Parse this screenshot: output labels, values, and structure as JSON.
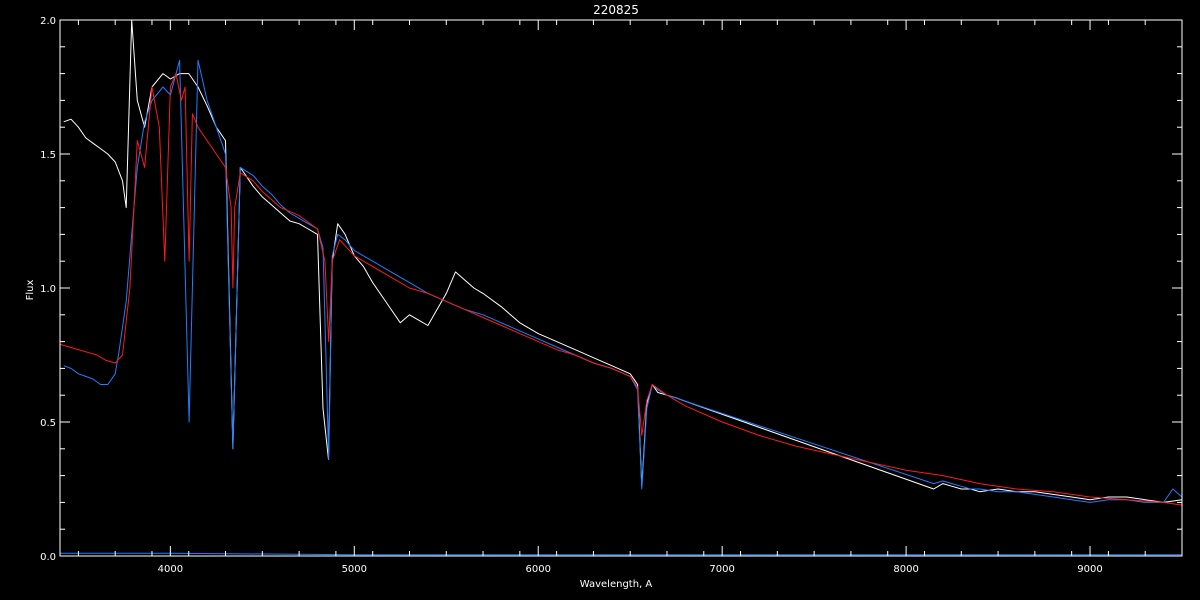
{
  "chart_data": {
    "type": "line",
    "title": "220825",
    "xlabel": "Wavelength, A",
    "ylabel": "Flux",
    "xlim": [
      3400,
      9500
    ],
    "ylim": [
      0,
      2.0
    ],
    "x_ticks": [
      4000,
      5000,
      6000,
      7000,
      8000,
      9000
    ],
    "x_tick_labels": [
      "4000",
      "5000",
      "6000",
      "7000",
      "8000",
      "9000"
    ],
    "y_ticks": [
      0,
      0.5,
      1.0,
      1.5,
      2.0
    ],
    "y_tick_labels": [
      "0.0",
      "0.5",
      "1.0",
      "1.5",
      "2.0"
    ],
    "grid": false,
    "colors": {
      "background": "#000000",
      "axes": "#ffffff",
      "white": "#ffffff",
      "blue": "#1e7fff",
      "red": "#ff1a1a"
    },
    "series": [
      {
        "color": "white",
        "x": [
          3420,
          3460,
          3500,
          3540,
          3580,
          3620,
          3660,
          3700,
          3740,
          3760,
          3790,
          3820,
          3860,
          3900,
          3960,
          4000,
          4050,
          4100,
          4150,
          4200,
          4250,
          4300,
          4340,
          4380,
          4450,
          4500,
          4550,
          4600,
          4650,
          4700,
          4750,
          4800,
          4830,
          4860,
          4880,
          4910,
          4950,
          5000,
          5050,
          5100,
          5150,
          5200,
          5250,
          5300,
          5350,
          5400,
          5450,
          5500,
          5550,
          5600,
          5650,
          5700,
          5800,
          5900,
          6000,
          6100,
          6200,
          6300,
          6400,
          6500,
          6540,
          6563,
          6590,
          6620,
          6650,
          6700,
          6750,
          6790,
          8150,
          8200,
          8250,
          8300,
          8350,
          8400,
          8500,
          8600,
          8700,
          8800,
          8900,
          9000,
          9100,
          9200,
          9300,
          9400,
          9500
        ],
        "y": [
          1.62,
          1.63,
          1.6,
          1.56,
          1.54,
          1.52,
          1.5,
          1.47,
          1.4,
          1.3,
          2.0,
          1.7,
          1.6,
          1.75,
          1.8,
          1.78,
          1.8,
          1.8,
          1.75,
          1.68,
          1.6,
          1.55,
          0.4,
          1.45,
          1.38,
          1.34,
          1.31,
          1.28,
          1.25,
          1.24,
          1.22,
          1.2,
          0.55,
          0.36,
          1.1,
          1.24,
          1.2,
          1.12,
          1.08,
          1.02,
          0.97,
          0.92,
          0.87,
          0.9,
          0.88,
          0.86,
          0.92,
          0.98,
          1.06,
          1.03,
          1.0,
          0.98,
          0.93,
          0.87,
          0.83,
          0.8,
          0.77,
          0.74,
          0.71,
          0.68,
          0.64,
          0.26,
          0.57,
          0.64,
          0.61,
          0.6,
          0.59,
          0.58,
          0.25,
          0.27,
          0.26,
          0.25,
          0.25,
          0.24,
          0.25,
          0.24,
          0.24,
          0.23,
          0.22,
          0.21,
          0.22,
          0.22,
          0.21,
          0.2,
          0.21
        ]
      },
      {
        "color": "blue",
        "x": [
          3420,
          3460,
          3500,
          3540,
          3580,
          3620,
          3660,
          3700,
          3720,
          3760,
          3790,
          3820,
          3860,
          3900,
          3960,
          4000,
          4050,
          4102,
          4150,
          4200,
          4250,
          4300,
          4340,
          4380,
          4450,
          4500,
          4550,
          4600,
          4650,
          4700,
          4750,
          4800,
          4830,
          4861,
          4880,
          4910,
          4950,
          5000,
          5100,
          5200,
          5300,
          5400,
          5500,
          5600,
          5700,
          5800,
          5900,
          6000,
          6100,
          6200,
          6300,
          6400,
          6500,
          6540,
          6563,
          6590,
          6620,
          6650,
          6700,
          6750,
          6790,
          8150,
          8200,
          8250,
          8300,
          8350,
          8400,
          8500,
          8600,
          8700,
          8800,
          8900,
          9000,
          9100,
          9200,
          9300,
          9400,
          9450,
          9500
        ],
        "y": [
          0.71,
          0.7,
          0.68,
          0.67,
          0.66,
          0.64,
          0.64,
          0.68,
          0.76,
          0.95,
          1.2,
          1.45,
          1.62,
          1.7,
          1.75,
          1.72,
          1.85,
          0.5,
          1.85,
          1.7,
          1.6,
          1.5,
          0.4,
          1.45,
          1.42,
          1.38,
          1.35,
          1.31,
          1.28,
          1.26,
          1.24,
          1.22,
          1.15,
          0.36,
          1.12,
          1.2,
          1.18,
          1.14,
          1.1,
          1.06,
          1.02,
          0.98,
          0.95,
          0.92,
          0.9,
          0.87,
          0.84,
          0.81,
          0.78,
          0.75,
          0.72,
          0.7,
          0.67,
          0.62,
          0.25,
          0.55,
          0.64,
          0.62,
          0.6,
          0.59,
          0.58,
          0.27,
          0.28,
          0.27,
          0.26,
          0.25,
          0.25,
          0.24,
          0.24,
          0.23,
          0.22,
          0.21,
          0.2,
          0.21,
          0.21,
          0.2,
          0.2,
          0.25,
          0.22
        ]
      },
      {
        "color": "red",
        "x": [
          3400,
          3450,
          3500,
          3550,
          3600,
          3650,
          3700,
          3740,
          3780,
          3820,
          3860,
          3900,
          3940,
          3970,
          4000,
          4030,
          4060,
          4080,
          4102,
          4120,
          4150,
          4200,
          4250,
          4300,
          4330,
          4340,
          4350,
          4380,
          4450,
          4500,
          4600,
          4700,
          4800,
          4840,
          4861,
          4880,
          4920,
          5000,
          5100,
          5200,
          5300,
          5400,
          5500,
          5600,
          5700,
          5800,
          5900,
          6000,
          6100,
          6200,
          6300,
          6400,
          6500,
          6540,
          6563,
          6590,
          6620,
          6700,
          6800,
          7000,
          7200,
          7400,
          7600,
          7800,
          8000,
          8200,
          8400,
          8600,
          8800,
          9000,
          9200,
          9400,
          9500
        ],
        "y": [
          0.79,
          0.78,
          0.77,
          0.76,
          0.75,
          0.73,
          0.72,
          0.75,
          1.0,
          1.55,
          1.45,
          1.75,
          1.6,
          1.1,
          1.75,
          1.8,
          1.7,
          1.75,
          1.1,
          1.65,
          1.6,
          1.55,
          1.5,
          1.45,
          1.3,
          1.0,
          1.3,
          1.43,
          1.4,
          1.36,
          1.3,
          1.27,
          1.22,
          1.1,
          0.8,
          1.1,
          1.18,
          1.12,
          1.08,
          1.04,
          1.0,
          0.98,
          0.95,
          0.92,
          0.89,
          0.86,
          0.83,
          0.8,
          0.77,
          0.75,
          0.72,
          0.7,
          0.67,
          0.63,
          0.45,
          0.58,
          0.64,
          0.6,
          0.56,
          0.5,
          0.45,
          0.41,
          0.38,
          0.35,
          0.32,
          0.3,
          0.27,
          0.25,
          0.24,
          0.22,
          0.21,
          0.2,
          0.19
        ]
      },
      {
        "color": "blue",
        "x": [
          3400,
          4000,
          5000,
          6000,
          7000,
          8000,
          9000,
          9500
        ],
        "y": [
          0.01,
          0.01,
          0.005,
          0.005,
          0.005,
          0.005,
          0.005,
          0.005
        ]
      }
    ]
  }
}
